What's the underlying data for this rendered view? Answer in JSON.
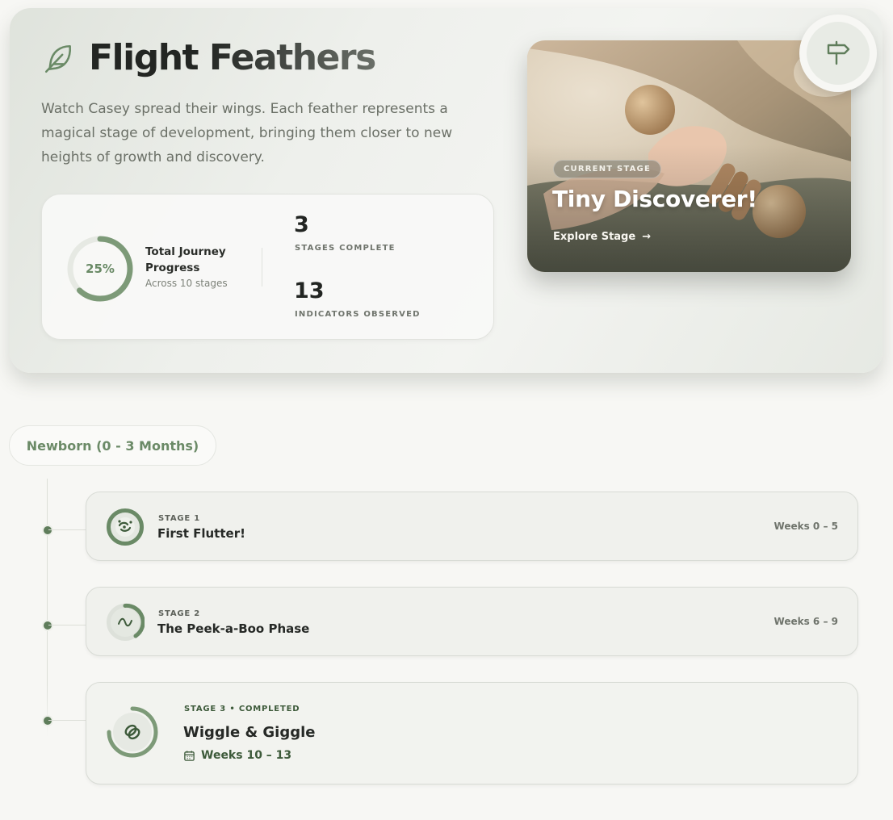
{
  "hero": {
    "title": "Flight Feathers",
    "description": "Watch Casey spread their wings. Each feather represents a magical stage of development, bringing them closer to new heights of growth and discovery."
  },
  "progress": {
    "percent_label": "25%",
    "percent": 25,
    "title": "Total Journey Progress",
    "subtitle": "Across 10 stages"
  },
  "stats": [
    {
      "value": "3",
      "label": "STAGES COMPLETE"
    },
    {
      "value": "13",
      "label": "INDICATORS OBSERVED"
    }
  ],
  "current_stage": {
    "badge": "CURRENT STAGE",
    "title": "Tiny Discoverer!",
    "link": "Explore Stage",
    "link_arrow": "→"
  },
  "timeline": {
    "age_group": "Newborn (0 - 3 Months)",
    "stages": [
      {
        "kicker": "STAGE 1",
        "name": "First Flutter!",
        "weeks": "Weeks 0 – 5"
      },
      {
        "kicker": "STAGE 2",
        "name": "The Peek-a-Boo Phase",
        "weeks": "Weeks 6 – 9"
      },
      {
        "kicker": "STAGE 3 • COMPLETED",
        "name": "Wiggle & Giggle",
        "weeks": "Weeks 10 – 13"
      }
    ]
  },
  "colors": {
    "accent": "#6a8a66",
    "accent_dark": "#3d5a3a",
    "background": "#f7f7f4"
  },
  "icons": {
    "title": "feather-icon",
    "signpost": "signpost-icon",
    "stage1": "confetti-icon",
    "stage2": "wave-icon",
    "stage3": "rings-icon",
    "calendar": "calendar-icon"
  }
}
